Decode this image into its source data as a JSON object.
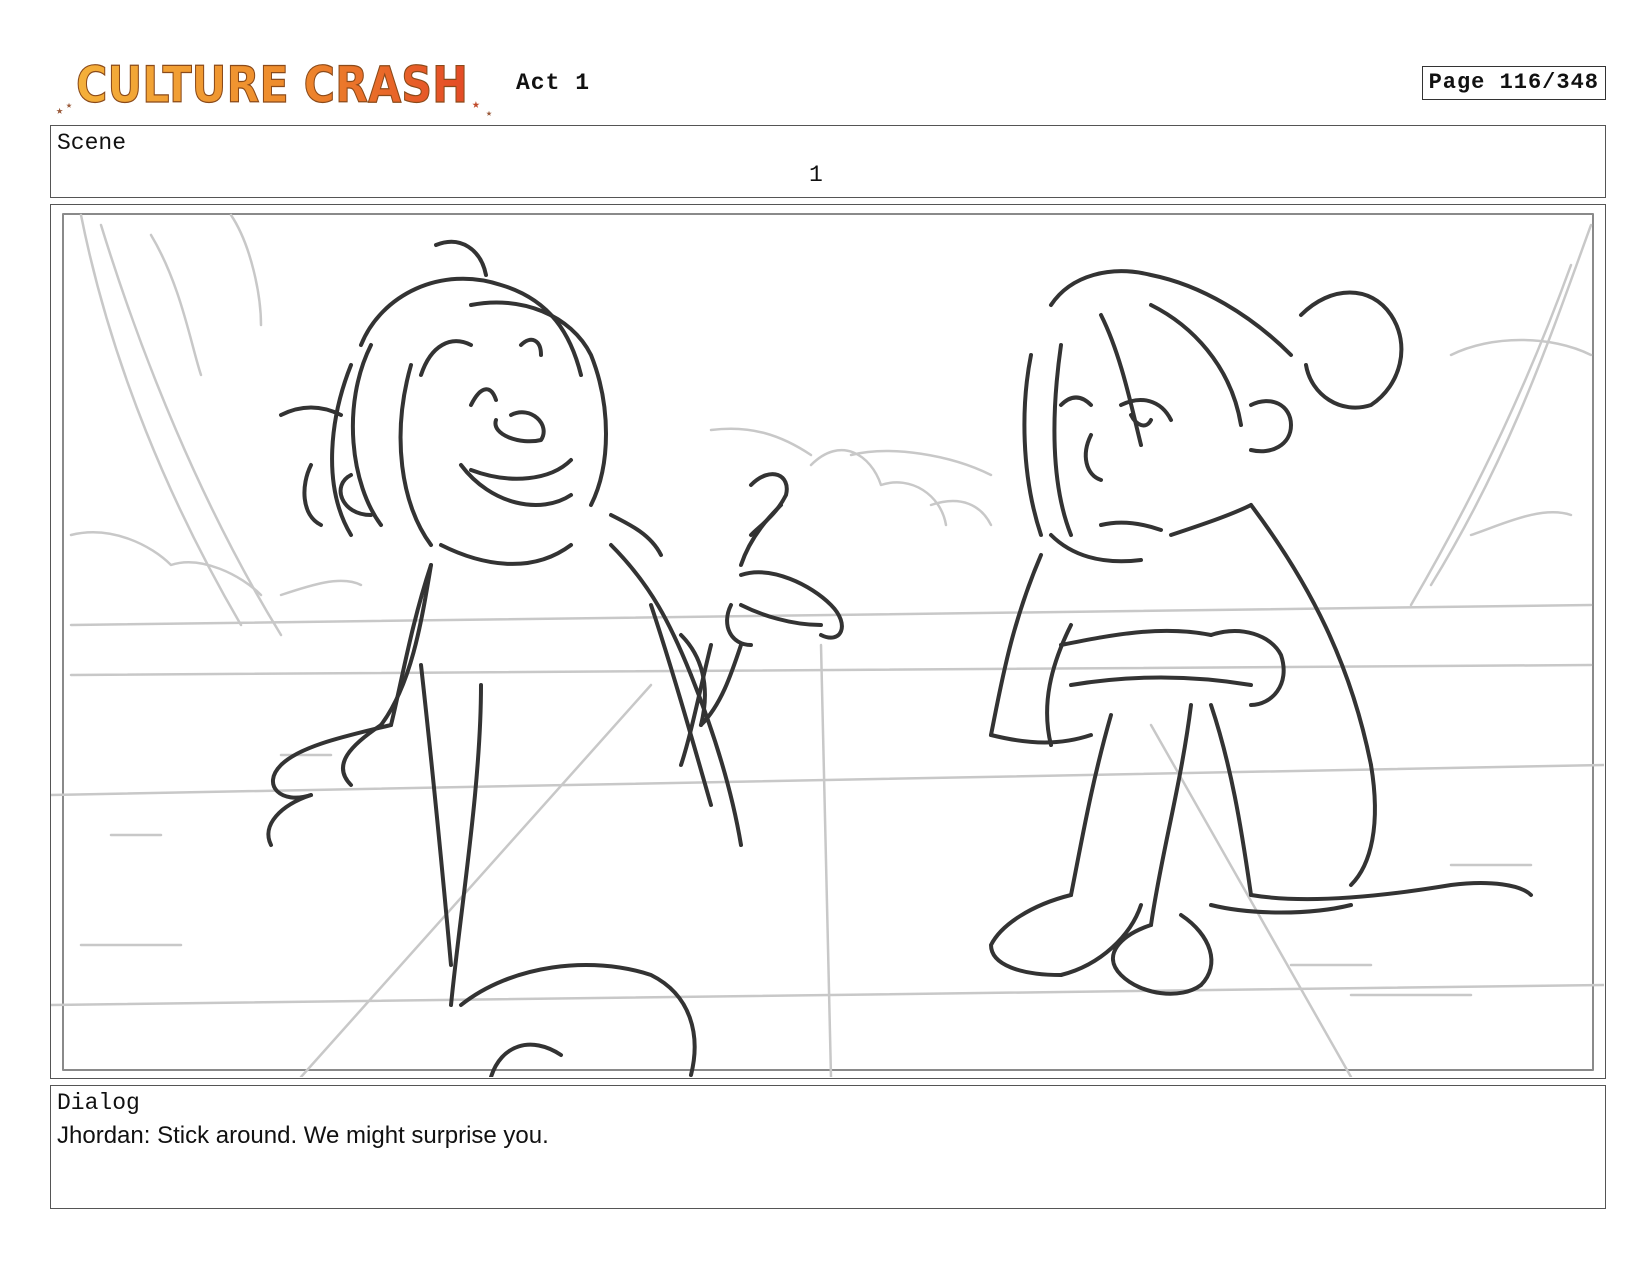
{
  "header": {
    "logo_text": "CULTURE CRASH",
    "act_label": "Act 1",
    "page_label": "Page 116/348"
  },
  "scene": {
    "label": "Scene",
    "value": "1"
  },
  "dialog": {
    "label": "Dialog",
    "text": "Jhordan: Stick around. We might surprise you."
  },
  "colors": {
    "logo_orange": "#f2a12b",
    "logo_red": "#e8522a",
    "sketch_dark": "#333333",
    "sketch_light": "#c8c8c8"
  }
}
